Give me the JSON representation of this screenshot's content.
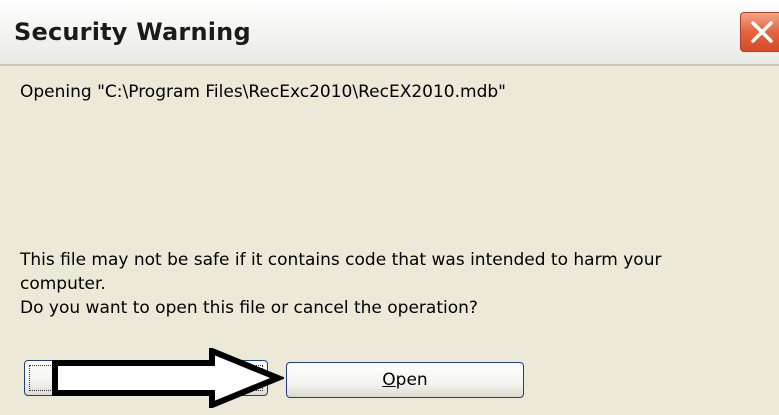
{
  "window": {
    "title": "Security Warning"
  },
  "message": {
    "opening": "Opening \"C:\\Program Files\\RecExc2010\\RecEX2010.mdb\"",
    "warning_line1": "This file may not be safe if it contains code that was intended to harm your",
    "warning_line2": "computer.",
    "question": "Do you want to open this file or cancel the operation?"
  },
  "buttons": {
    "open_mnemonic": "O",
    "open_rest": "pen",
    "left_label": ""
  },
  "icons": {
    "close": "close-icon",
    "annotation": "right-arrow-icon"
  },
  "colors": {
    "close_red": "#e4643f",
    "dialog_bg": "#ece9d8",
    "button_border": "#1f3f7a"
  }
}
